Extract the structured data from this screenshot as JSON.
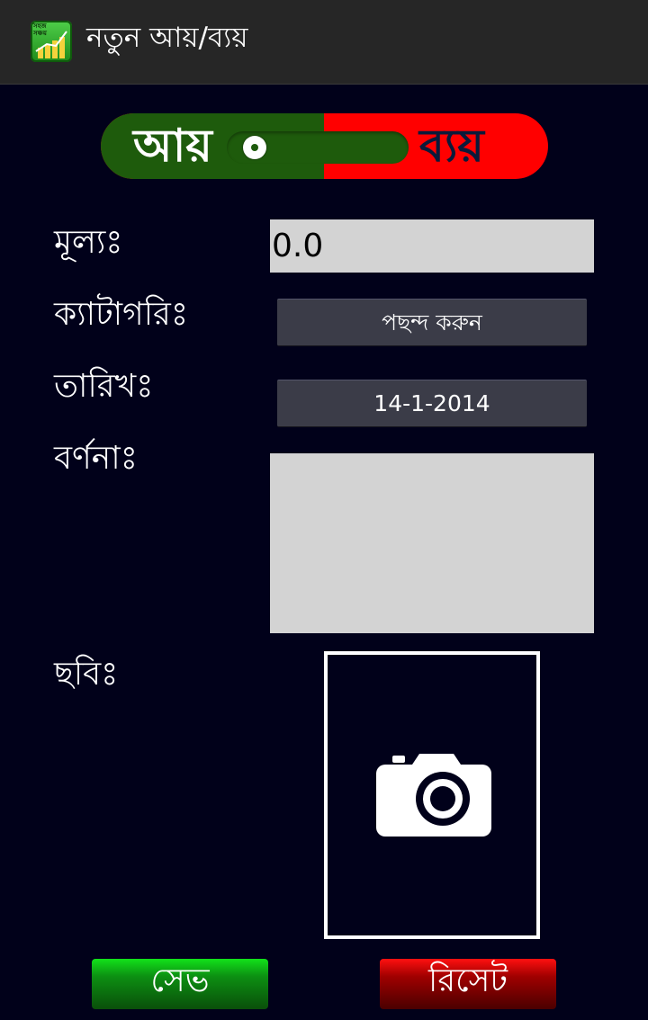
{
  "action_bar": {
    "icon_text": "সহজ সঞ্চয়",
    "title": "নতুন আয়/ব্যয়"
  },
  "type_toggle": {
    "income_label": "আয়",
    "expense_label": "ব্যয়",
    "selected": "income",
    "colors": {
      "income": "#1e5b0c",
      "expense": "#ff0000"
    }
  },
  "form": {
    "amount_label": "মূল্যঃ",
    "amount_value": "0.0",
    "category_label": "ক্যাটাগরিঃ",
    "category_value": "পছন্দ করুন",
    "date_label": "তারিখঃ",
    "date_value": "14-1-2014",
    "description_label": "বর্ণনাঃ",
    "description_value": "",
    "photo_label": "ছবিঃ",
    "photo_icon": "camera-icon"
  },
  "buttons": {
    "save_label": "সেভ",
    "reset_label": "রিসেট"
  }
}
